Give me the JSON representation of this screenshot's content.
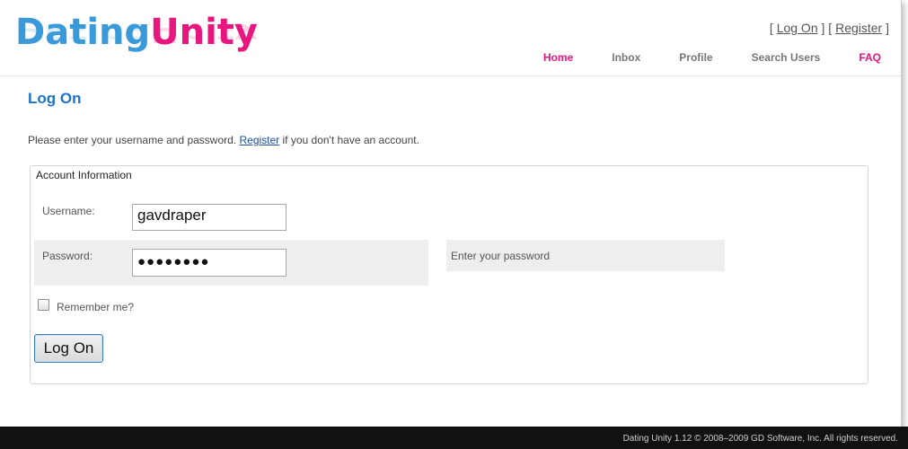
{
  "brand": {
    "part1": "Dating",
    "part2": "Unity"
  },
  "account_links": {
    "open": "[",
    "log_on": "Log On",
    "mid": "] [",
    "register": "Register",
    "close": "]"
  },
  "nav": [
    {
      "label": "Home",
      "active": true
    },
    {
      "label": "Inbox",
      "active": false
    },
    {
      "label": "Profile",
      "active": false
    },
    {
      "label": "Search Users",
      "active": false
    },
    {
      "label": "FAQ",
      "active": true
    }
  ],
  "page": {
    "title": "Log On",
    "intro_before": "Please enter your username and password.",
    "intro_link": "Register",
    "intro_after": "if you don't have an account."
  },
  "form": {
    "legend": "Account Information",
    "username_label": "Username:",
    "username_value": "gavdraper",
    "password_label": "Password:",
    "password_value": "●●●●●●●●",
    "password_hint": "Enter your password",
    "remember_label": "Remember me?",
    "remember_checked": false,
    "submit_label": "Log On"
  },
  "footer": {
    "text": "Dating Unity 1.12 © 2008–2009 GD Software, Inc. All rights reserved."
  },
  "colors": {
    "brand_blue": "#3a9ad9",
    "brand_pink": "#e8177e",
    "title_blue": "#1e73c8"
  }
}
